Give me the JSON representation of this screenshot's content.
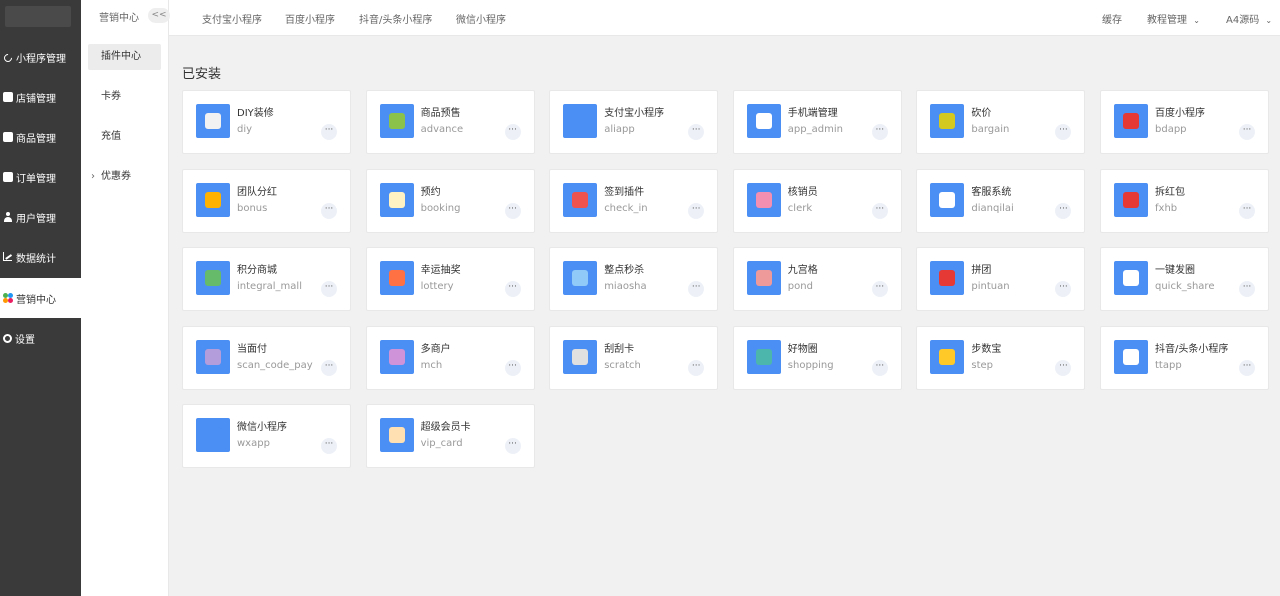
{
  "sidebar": {
    "items": [
      {
        "label": "小程序管理",
        "icon": "link-icon"
      },
      {
        "label": "店铺管理",
        "icon": "store-icon"
      },
      {
        "label": "商品管理",
        "icon": "mail-icon"
      },
      {
        "label": "订单管理",
        "icon": "clipboard-icon"
      },
      {
        "label": "用户管理",
        "icon": "user-icon"
      },
      {
        "label": "数据统计",
        "icon": "chart-icon"
      },
      {
        "label": "营销中心",
        "icon": "marketing-icon"
      },
      {
        "label": "设置",
        "icon": "gear-icon"
      }
    ]
  },
  "subnav": {
    "title": "营销中心",
    "collapse_label": "<<",
    "items": [
      {
        "label": "插件中心"
      },
      {
        "label": "卡券"
      },
      {
        "label": "充值"
      },
      {
        "label": "优惠券"
      }
    ]
  },
  "topbar": {
    "tabs": [
      "支付宝小程序",
      "百度小程序",
      "抖音/头条小程序",
      "微信小程序"
    ],
    "cache": "缓存",
    "tutorial": "教程管理",
    "source": "A4源码"
  },
  "section_title": "已安装",
  "plugins": [
    {
      "name": "DIY装修",
      "code": "diy",
      "color": "#f2f2f2"
    },
    {
      "name": "商品预售",
      "code": "advance",
      "color": "#8bc34a"
    },
    {
      "name": "支付宝小程序",
      "code": "aliapp",
      "color": "#4b8ef4"
    },
    {
      "name": "手机端管理",
      "code": "app_admin",
      "color": "#ffffff"
    },
    {
      "name": "砍价",
      "code": "bargain",
      "color": "#d4c91e"
    },
    {
      "name": "百度小程序",
      "code": "bdapp",
      "color": "#e53935"
    },
    {
      "name": "团队分红",
      "code": "bonus",
      "color": "#ffb300"
    },
    {
      "name": "预约",
      "code": "booking",
      "color": "#fff3c4"
    },
    {
      "name": "签到插件",
      "code": "check_in",
      "color": "#ef5350"
    },
    {
      "name": "核销员",
      "code": "clerk",
      "color": "#f48fb1"
    },
    {
      "name": "客服系统",
      "code": "dianqilai",
      "color": "#ffffff"
    },
    {
      "name": "拆红包",
      "code": "fxhb",
      "color": "#e53935"
    },
    {
      "name": "积分商城",
      "code": "integral_mall",
      "color": "#66bb6a"
    },
    {
      "name": "幸运抽奖",
      "code": "lottery",
      "color": "#ff7043"
    },
    {
      "name": "整点秒杀",
      "code": "miaosha",
      "color": "#90caf9"
    },
    {
      "name": "九宫格",
      "code": "pond",
      "color": "#ef9a9a"
    },
    {
      "name": "拼团",
      "code": "pintuan",
      "color": "#e53935"
    },
    {
      "name": "一键发圈",
      "code": "quick_share",
      "color": "#ffffff"
    },
    {
      "name": "当面付",
      "code": "scan_code_pay",
      "color": "#b39ddb"
    },
    {
      "name": "多商户",
      "code": "mch",
      "color": "#ce93d8"
    },
    {
      "name": "刮刮卡",
      "code": "scratch",
      "color": "#e0e0e0"
    },
    {
      "name": "好物圈",
      "code": "shopping",
      "color": "#4db6ac"
    },
    {
      "name": "步数宝",
      "code": "step",
      "color": "#ffca28"
    },
    {
      "name": "抖音/头条小程序",
      "code": "ttapp",
      "color": "#ffffff"
    },
    {
      "name": "微信小程序",
      "code": "wxapp",
      "color": "#4b8ef4"
    },
    {
      "name": "超级会员卡",
      "code": "vip_card",
      "color": "#ffe0b2"
    }
  ],
  "more_label": "···"
}
